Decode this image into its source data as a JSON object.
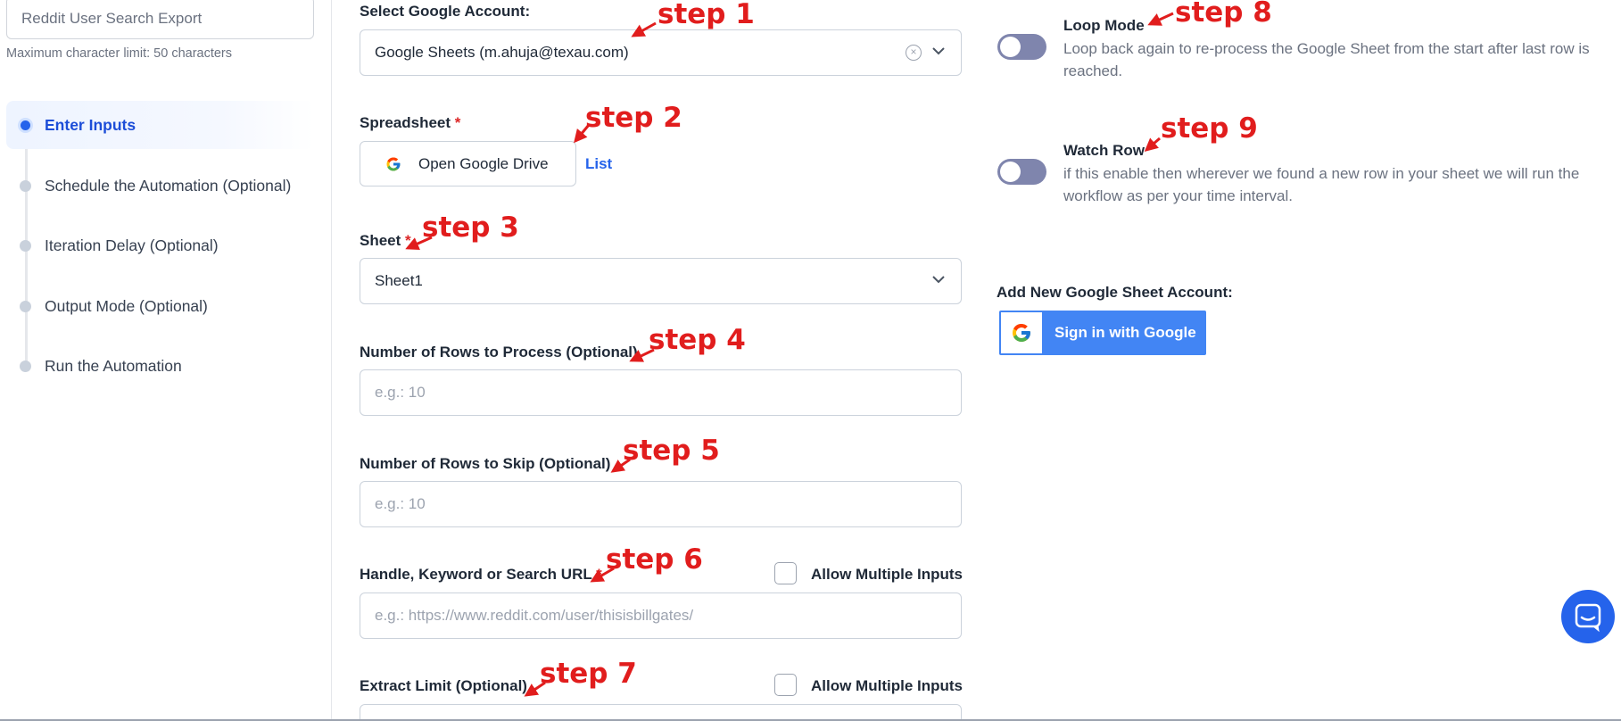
{
  "sidebar": {
    "name_input_value": "Reddit User Search Export",
    "char_hint": "Maximum character limit: 50 characters",
    "steps": [
      {
        "label": "Enter Inputs",
        "active": true
      },
      {
        "label": "Schedule the Automation (Optional)",
        "active": false
      },
      {
        "label": "Iteration Delay (Optional)",
        "active": false
      },
      {
        "label": "Output Mode (Optional)",
        "active": false
      },
      {
        "label": "Run the Automation",
        "active": false
      }
    ]
  },
  "form": {
    "account_label": "Select Google Account:",
    "account_value": "Google Sheets (m.ahuja@texau.com)",
    "spreadsheet_label": "Spreadsheet",
    "drive_button": "Open Google Drive",
    "list_link": "List",
    "sheet_label": "Sheet",
    "sheet_value": "Sheet1",
    "rows_process_label": "Number of Rows to Process (Optional)",
    "rows_process_placeholder": "e.g.: 10",
    "rows_skip_label": "Number of Rows to Skip (Optional)",
    "rows_skip_placeholder": "e.g.: 10",
    "handle_label": "Handle, Keyword or Search URL",
    "handle_placeholder": "e.g.: https://www.reddit.com/user/thisisbillgates/",
    "allow_multiple": "Allow Multiple Inputs",
    "extract_label": "Extract Limit (Optional)",
    "required_mark": "*"
  },
  "options": {
    "loop_title": "Loop Mode",
    "loop_desc": "Loop back again to re-process the Google Sheet from the start after last row is reached.",
    "loop_on": false,
    "watch_title": "Watch Row",
    "watch_desc": "if this enable then wherever we found a new row in your sheet we will run the workflow as per your time interval.",
    "watch_on": false,
    "add_account_label": "Add New Google Sheet Account:",
    "sign_in_label": "Sign in with Google"
  },
  "annotations": {
    "step1": "step 1",
    "step2": "step 2",
    "step3": "step 3",
    "step4": "step 4",
    "step5": "step 5",
    "step6": "step 6",
    "step7": "step 7",
    "step8": "step 8",
    "step9": "step 9",
    "color": "#e11d1d"
  },
  "icons": {
    "clear": "clear-circle-icon",
    "dropdown": "chevron-down-icon",
    "google": "google-g-icon",
    "chat": "chat-bubble-icon"
  }
}
